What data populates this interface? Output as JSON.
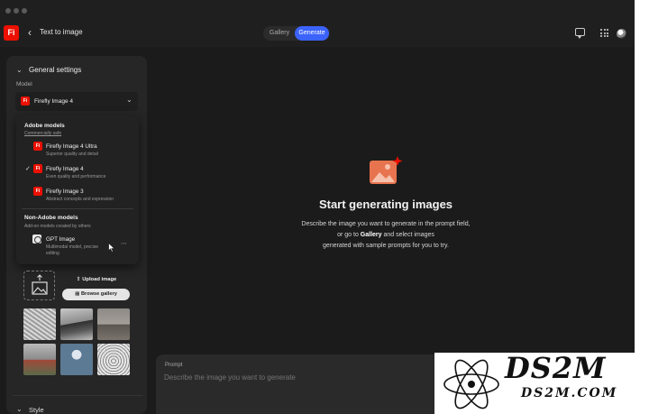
{
  "colors": {
    "accent": "#3b63fb",
    "brand": "#eb1000",
    "background": "#1b1b1b",
    "panel": "#262626"
  },
  "header": {
    "logo_text": "Fi",
    "back_icon": "chevron-left-icon",
    "title": "Text to image",
    "tabs": [
      {
        "label": "Gallery",
        "active": false
      },
      {
        "label": "Generate",
        "active": true
      }
    ],
    "icons": [
      "feedback-icon",
      "apps-grid-icon",
      "profile-avatar"
    ]
  },
  "settings": {
    "section_title": "General settings",
    "model_label": "Model",
    "selected_model": "Firefly Image 4",
    "style_label": "Style"
  },
  "model_dropdown": {
    "adobe_heading": "Adobe models",
    "adobe_sub": "Commercially safe",
    "adobe_models": [
      {
        "name": "Firefly Image 4 Ultra",
        "desc": "Superior quality and detail",
        "selected": false
      },
      {
        "name": "Firefly Image 4",
        "desc": "Even quality and performance",
        "selected": true
      },
      {
        "name": "Firefly Image 3",
        "desc": "Abstract concepts and expression",
        "selected": false
      }
    ],
    "non_adobe_heading": "Non-Adobe models",
    "non_adobe_sub": "Add-on models created by others",
    "non_adobe_models": [
      {
        "name": "GPT Image",
        "desc_line1": "Multimodal model, precise",
        "desc_line2": "editing"
      }
    ]
  },
  "composition": {
    "upload_label": "Upload image",
    "browse_label": "Browse gallery"
  },
  "empty_state": {
    "title": "Start generating images",
    "line1": "Describe the image you want to generate in the prompt field,",
    "line2_pre": "or go to ",
    "line2_bold": "Gallery",
    "line2_post": " and select images",
    "line3": "generated with sample prompts for you to try."
  },
  "prompt": {
    "label": "Prompt",
    "placeholder": "Describe the image you want to generate"
  },
  "watermark": {
    "big": "DS2M",
    "small": "DS2M.COM"
  }
}
